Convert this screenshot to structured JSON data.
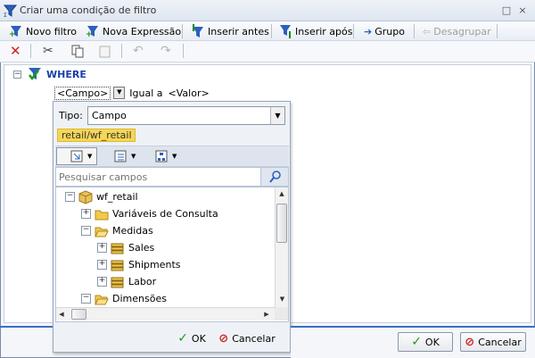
{
  "window": {
    "title": "Criar uma condição de filtro",
    "controls": [
      "□",
      "×"
    ]
  },
  "toolbar": {
    "novo_filtro": "Novo filtro",
    "nova_expressao": "Nova Expressão",
    "inserir_antes": "Inserir antes",
    "inserir_apos": "Inserir após",
    "grupo": "Grupo",
    "desagrupar": "Desagrupar"
  },
  "where": {
    "label": "WHERE",
    "field": "<Campo>",
    "operator": "Igual a",
    "value": "<Valor>"
  },
  "popup": {
    "tipo_label": "Tipo:",
    "tipo_value": "Campo",
    "source_chip": "retail/wf_retail",
    "search_placeholder": "Pesquisar campos",
    "tree": [
      {
        "label": "wf_retail",
        "level": 0,
        "expander": "−",
        "icon": "cube-icon"
      },
      {
        "label": "Variáveis de Consulta",
        "level": 1,
        "expander": "+",
        "icon": "folder-icon"
      },
      {
        "label": "Medidas",
        "level": 1,
        "expander": "−",
        "icon": "folder-open-icon"
      },
      {
        "label": "Sales",
        "level": 2,
        "expander": "+",
        "icon": "measure-group-icon"
      },
      {
        "label": "Shipments",
        "level": 2,
        "expander": "+",
        "icon": "measure-group-icon"
      },
      {
        "label": "Labor",
        "level": 2,
        "expander": "+",
        "icon": "measure-group-icon"
      },
      {
        "label": "Dimensões",
        "level": 1,
        "expander": "−",
        "icon": "folder-open-icon"
      }
    ],
    "ok": "OK",
    "cancel": "Cancelar"
  },
  "footer": {
    "ok": "OK",
    "cancel": "Cancelar"
  },
  "colors": {
    "accent": "#3b6fc7",
    "where": "#1a3faa",
    "chip": "#f5d657"
  }
}
